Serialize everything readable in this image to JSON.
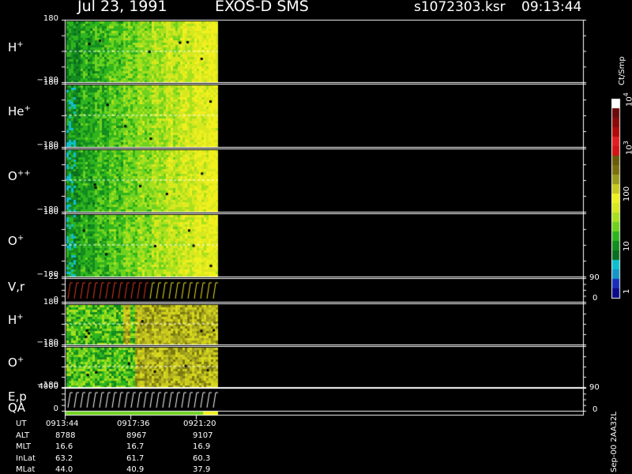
{
  "header": {
    "date": "Jul 23, 1991",
    "instrument": "EXOS-D SMS",
    "file": "s1072303.ksr",
    "time": "09:13:44"
  },
  "chart_data": {
    "type": "heatmap",
    "panels": [
      {
        "id": "h1",
        "label": "H",
        "sup": "+",
        "ymax": "180",
        "ymin": "−180"
      },
      {
        "id": "he",
        "label": "He",
        "sup": "+",
        "ymax": "180",
        "ymin": "−180"
      },
      {
        "id": "opp",
        "label": "O",
        "sup": "++",
        "ymax": "180",
        "ymin": "−180"
      },
      {
        "id": "o1",
        "label": "O",
        "sup": "+",
        "ymax": "180",
        "ymin": "−180"
      },
      {
        "id": "vr",
        "label": "V,r",
        "sup": "",
        "ymax": "25",
        "ymin": "0",
        "right_max": "90",
        "right_min": "0"
      },
      {
        "id": "h2",
        "label": "H",
        "sup": "+",
        "ymax": "180",
        "ymin": "−180"
      },
      {
        "id": "o2",
        "label": "O",
        "sup": "+",
        "ymax": "180",
        "ymin": "−180"
      },
      {
        "id": "ep",
        "label": "E,p",
        "sup": "",
        "ymax": "4000",
        "ymin": "0",
        "right_max": "90",
        "right_min": "0"
      }
    ],
    "qa_label": "QA",
    "colorbar": {
      "unit": "Ct/Smp",
      "ticks": [
        "1",
        "10",
        "100",
        "10",
        "10"
      ],
      "tick_exponents": [
        "",
        "",
        "",
        "3",
        "4"
      ],
      "colors": [
        "#0b0b88",
        "#1a2fb8",
        "#1496c8",
        "#0fbfcf",
        "#0a6e1e",
        "#148c1e",
        "#2fb41e",
        "#6fd21e",
        "#a8e01e",
        "#d8e81e",
        "#f0f01e",
        "#c8c81e",
        "#9a9a1e",
        "#7a6e10",
        "#6a5a0a",
        "#d21414",
        "#e01e1e",
        "#b00a0a",
        "#8a0a0a",
        "#6a0a0a",
        "#ffffff"
      ]
    },
    "data_extent_fraction": 0.29
  },
  "ephemeris": {
    "labels": [
      "UT",
      "ALT",
      "MLT",
      "InLat",
      "MLat"
    ],
    "columns": [
      [
        "0913:44",
        "8788",
        "16.6",
        "63.2",
        "44.0"
      ],
      [
        "0917:36",
        "8967",
        "16.7",
        "61.7",
        "40.9"
      ],
      [
        "0921:20",
        "9107",
        "16.9",
        "60.3",
        "37.9"
      ]
    ]
  },
  "footer": {
    "code": "Sep-00 2AA32L"
  }
}
